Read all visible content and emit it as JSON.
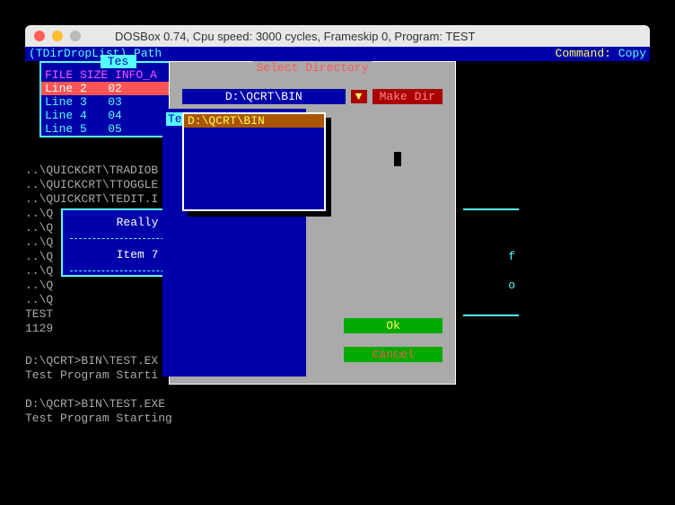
{
  "window": {
    "title": "DOSBox 0.74, Cpu speed:    3000 cycles, Frameskip  0, Program:    TEST"
  },
  "status": {
    "left": "(TDirDropList) Path",
    "cmd_label": "Command:",
    "cmd_value": "Copy"
  },
  "list": {
    "title": "Tes",
    "header": "FILE SIZE INFO_A",
    "rows": [
      {
        "c1": "Line 2",
        "c2": "02"
      },
      {
        "c1": "Line 3",
        "c2": "03"
      },
      {
        "c1": "Line 4",
        "c2": "04"
      },
      {
        "c1": "Line 5",
        "c2": "05"
      }
    ]
  },
  "bg_lines": [
    "..\\QUICKCRT\\TRADIOB",
    "..\\QUICKCRT\\TTOGGLE",
    "..\\QUICKCRT\\TEDIT.I",
    "..\\Q",
    "..\\Q",
    "..\\Q",
    "..\\Q",
    "..\\Q",
    "..\\Q",
    "..\\Q",
    "TEST",
    "1129"
  ],
  "info_letters": {
    "a": "f",
    "b": "o"
  },
  "popup": {
    "item1": "Really",
    "item2": "Item 7"
  },
  "dialog": {
    "title": "Select Directory",
    "path": "D:\\QCRT\\BIN",
    "make_dir": "Make Dir",
    "list_label": "Te",
    "selected_dir": "D:\\QCRT\\BIN",
    "ok": "Ok",
    "cancel": "Cancel",
    "dropdown_glyph": "▼"
  },
  "prompts": [
    "D:\\QCRT>BIN\\TEST.EX",
    "Test Program Starti",
    "",
    "D:\\QCRT>BIN\\TEST.EXE",
    "Test Program Starting"
  ]
}
